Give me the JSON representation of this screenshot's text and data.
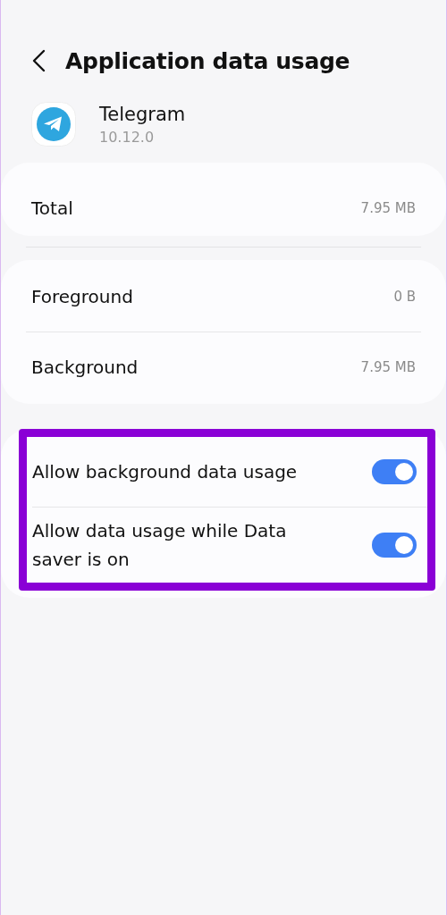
{
  "header": {
    "title": "Application data usage"
  },
  "app": {
    "name": "Telegram",
    "version": "10.12.0"
  },
  "total": {
    "label": "Total",
    "value": "7.95 MB"
  },
  "usage": [
    {
      "label": "Foreground",
      "value": "0 B"
    },
    {
      "label": "Background",
      "value": "7.95 MB"
    }
  ],
  "settings": {
    "highlighted": true,
    "items": [
      {
        "label": "Allow background data usage",
        "on": true
      },
      {
        "label": "Allow data usage while Data saver is on",
        "on": true
      }
    ]
  }
}
